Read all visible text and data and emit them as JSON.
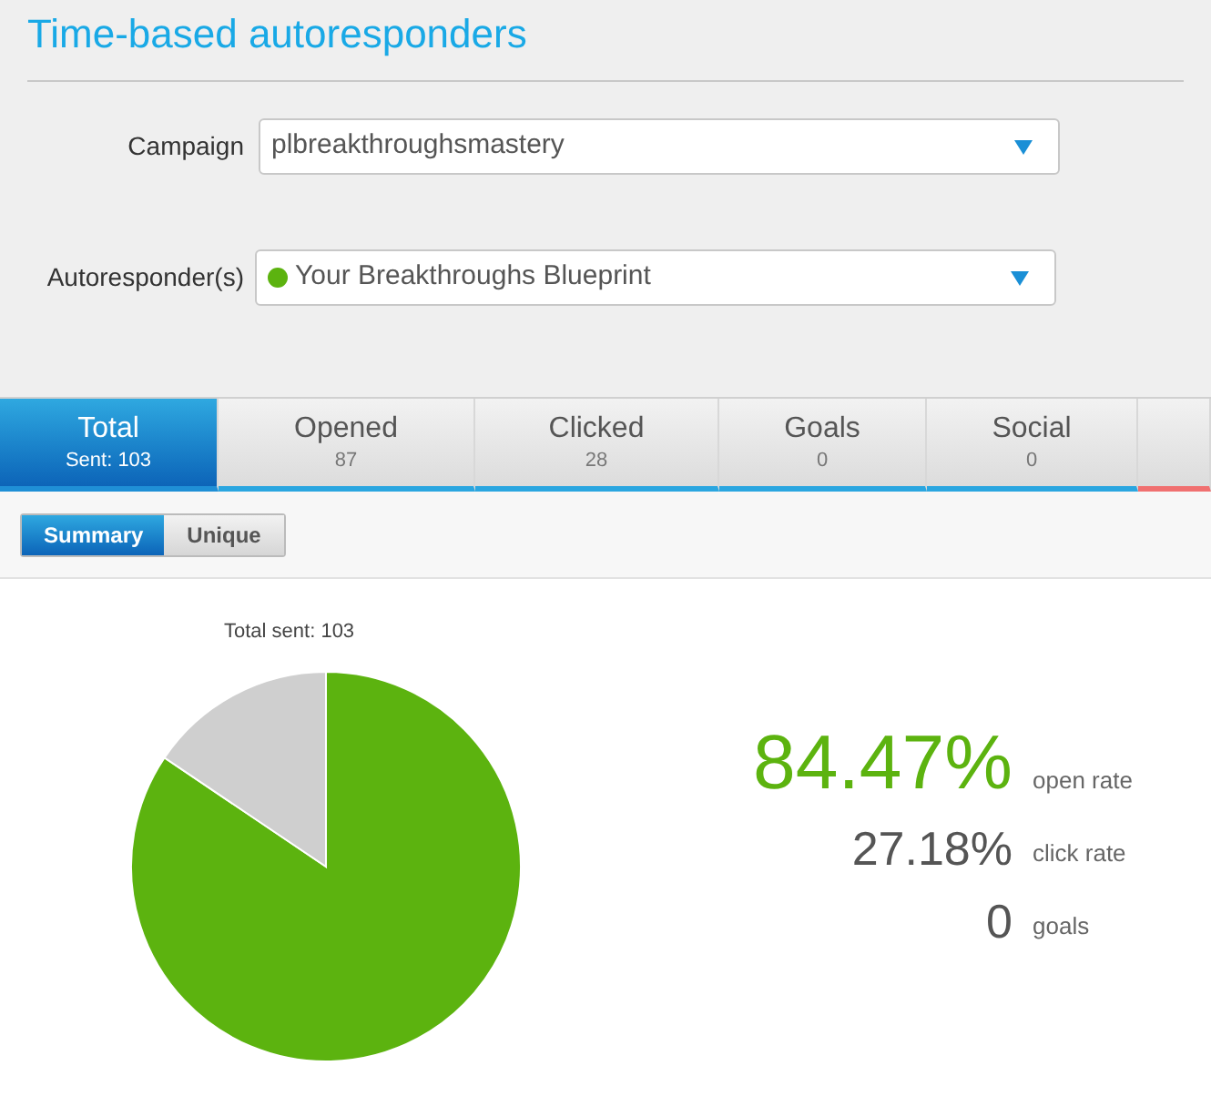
{
  "title": "Time-based autoresponders",
  "filters": [
    {
      "label": "Campaign",
      "value": "plbreakthroughsmastery",
      "status_dot": false
    },
    {
      "label": "Autoresponder(s)",
      "value": "Your Breakthroughs Blueprint",
      "status_dot": true
    }
  ],
  "tabs": [
    {
      "label": "Total",
      "count": "Sent: 103",
      "selected": true,
      "color": "#1f8fd6"
    },
    {
      "label": "Opened",
      "count": "87",
      "selected": false,
      "color": "#2aa6e0"
    },
    {
      "label": "Clicked",
      "count": "28",
      "selected": false,
      "color": "#2aa6e0"
    },
    {
      "label": "Goals",
      "count": "0",
      "selected": false,
      "color": "#2aa6e0"
    },
    {
      "label": "Social",
      "count": "0",
      "selected": false,
      "color": "#2aa6e0"
    },
    {
      "selected": false,
      "color": "#f07070"
    }
  ],
  "view_toggle": [
    {
      "label": "Summary",
      "selected": true
    },
    {
      "label": "Unique",
      "selected": false
    }
  ],
  "chart_title": "Total sent: 103",
  "stats": [
    {
      "value": "84.47%",
      "label": "open rate",
      "kind": "primary"
    },
    {
      "value": "27.18%",
      "label": "click rate",
      "kind": "secondary"
    },
    {
      "value": "0",
      "label": "goals",
      "kind": "secondary"
    }
  ]
}
